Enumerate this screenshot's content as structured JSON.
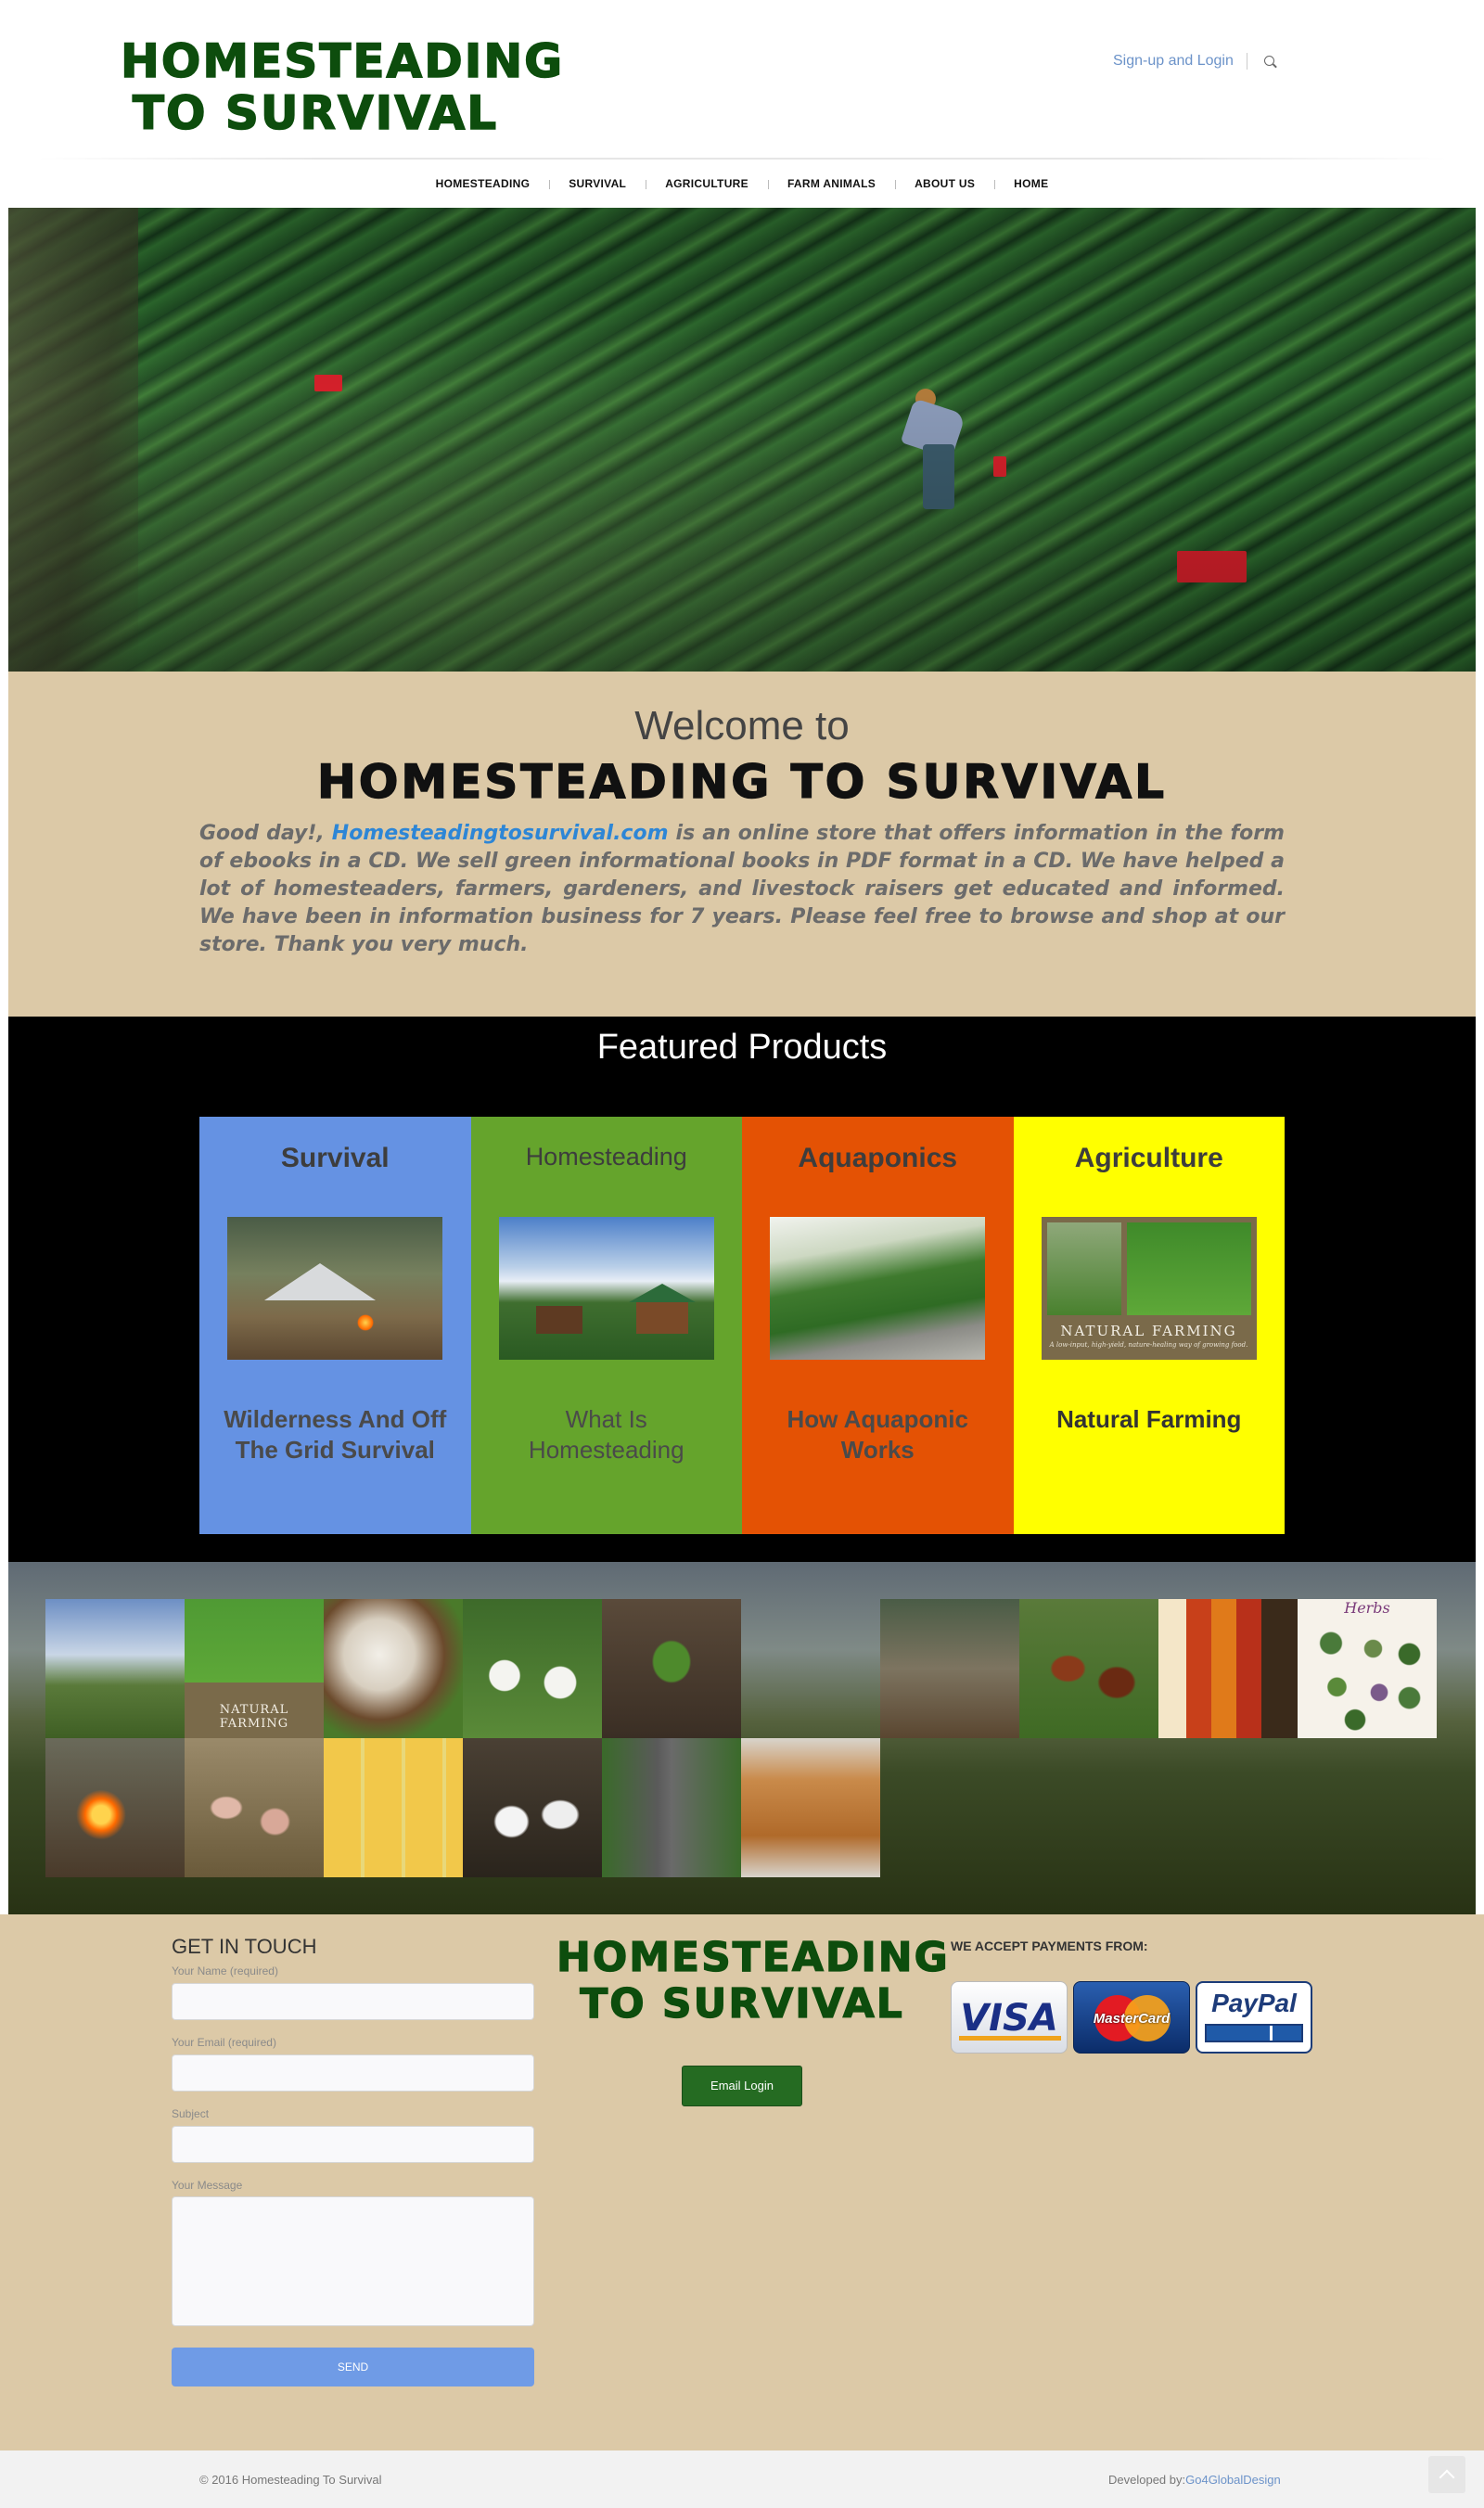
{
  "header": {
    "logo_text": "HOMESTEADING TO SURVIVAL",
    "signup_label": "Sign-up and Login",
    "search_icon": "search-icon"
  },
  "nav": {
    "items": [
      "HOMESTEADING",
      "SURVIVAL",
      "AGRICULTURE",
      "FARM ANIMALS",
      "ABOUT US",
      "HOME"
    ]
  },
  "welcome": {
    "heading": "Welcome to",
    "title": "HOMESTEADING TO SURVIVAL",
    "text_before": "Good day!, ",
    "link_text": "Homesteadingtosurvival.com",
    "text_after": " is an online store that offers information in the form of ebooks in a CD. We sell green informational books in PDF format in a CD. We have helped a lot of homesteaders, farmers, gardeners, and livestock raisers get educated and informed. We have been in information business for 7 years. Please feel free to browse and shop at our store. Thank you very much."
  },
  "featured": {
    "title": "Featured Products",
    "products": [
      {
        "category": "Survival",
        "name": "Wilderness And Off The Grid Survival",
        "color": "#6592e3"
      },
      {
        "category": "Homesteading",
        "name": "What Is Homesteading",
        "color": "#65a42c"
      },
      {
        "category": "Aquaponics",
        "name": "How Aquaponic Works",
        "color": "#e45204"
      },
      {
        "category": "Agriculture",
        "name": "Natural Farming",
        "color": "#ffff00"
      }
    ],
    "book_title": "NATURAL FARMING",
    "book_subtitle": "A low-input, high-yield, nature-healing way of growing food."
  },
  "gallery": {
    "book_title": "NATURAL FARMING",
    "herbs_title": "Herbs"
  },
  "footer": {
    "contact_title": "GET IN TOUCH",
    "name_label": "Your Name (required)",
    "email_label": "Your Email (required)",
    "subject_label": "Subject",
    "message_label": "Your Message",
    "send_label": "SEND",
    "logo_text": "HOMESTEADING TO SURVIVAL",
    "email_login_label": "Email Login",
    "payments_title": "WE ACCEPT PAYMENTS FROM:",
    "visa_label": "VISA",
    "mastercard_label": "MasterCard",
    "paypal_label": "PayPal",
    "copyright": "© 2016 Homesteading To Survival",
    "developer_prefix": "Developed by:",
    "developer_link": "Go4GlobalDesign"
  }
}
